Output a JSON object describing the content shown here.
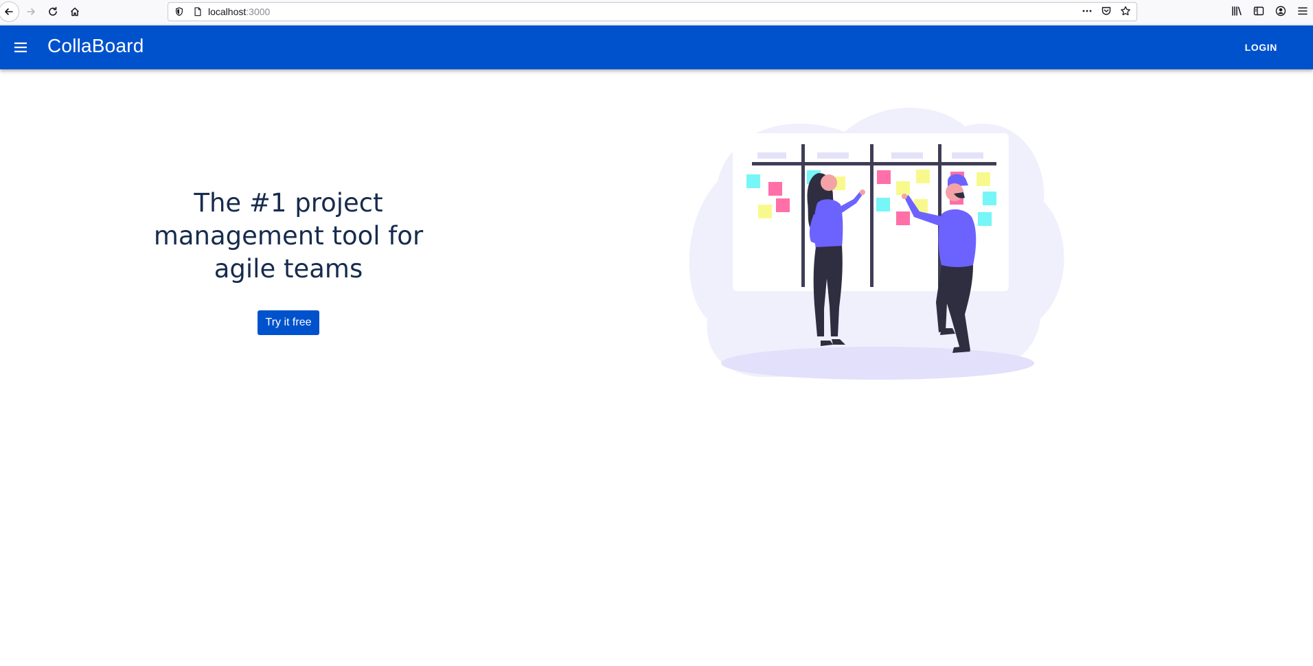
{
  "browser": {
    "url_host": "localhost",
    "url_port": ":3000"
  },
  "appbar": {
    "title": "CollaBoard",
    "login_label": "LOGIN",
    "background_color": "#0052cc"
  },
  "hero": {
    "headline_line1": "The #1 project",
    "headline_line2": "management tool for",
    "headline_line3": "agile teams",
    "cta_label": "Try it free",
    "cta_color": "#0052cc",
    "text_color": "#172b4d"
  },
  "illustration": {
    "icon": "kanban-board-team-illustration",
    "accent_colors": [
      "#6c63ff",
      "#ff6584",
      "#f8f98c",
      "#76f6f6",
      "#2f2e41"
    ]
  }
}
